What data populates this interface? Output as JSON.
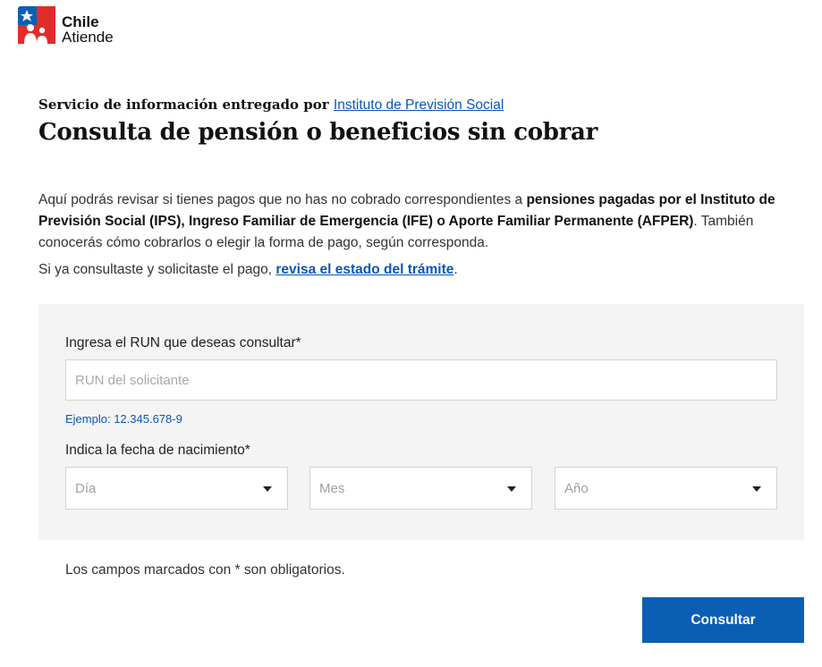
{
  "brand": {
    "line1": "Chile",
    "line2": "Atiende"
  },
  "header": {
    "provider_prefix": "Servicio de información entregado por",
    "provider_link": "Instituto de Previsión Social",
    "title": "Consulta de pensión o beneficios sin cobrar"
  },
  "intro": {
    "p1_a": "Aquí podrás revisar si tienes pagos que no has no cobrado correspondientes a ",
    "p1_bold": "pensiones pagadas por el Instituto de Previsión Social (IPS), Ingreso Familiar de Emergencia (IFE) o Aporte Familiar Permanente (AFPER)",
    "p1_b": ". También conocerás cómo cobrarlos o elegir la forma de pago, según corresponda.",
    "p2_a": "Si ya consultaste y solicitaste el pago, ",
    "p2_link": "revisa el estado del trámite",
    "p2_b": "."
  },
  "form": {
    "run_label": "Ingresa el RUN que deseas consultar*",
    "run_placeholder": "RUN del solicitante",
    "run_hint": "Ejemplo: 12.345.678-9",
    "dob_label": "Indica la fecha de nacimiento*",
    "day_placeholder": "Día",
    "month_placeholder": "Mes",
    "year_placeholder": "Año"
  },
  "required_note": "Los campos marcados con * son obligatorios.",
  "submit_label": "Consultar",
  "colors": {
    "brand_blue": "#0a5fb4",
    "link_blue": "#0a57b5",
    "brand_red": "#e22c2c",
    "form_bg": "#f4f4f4"
  }
}
